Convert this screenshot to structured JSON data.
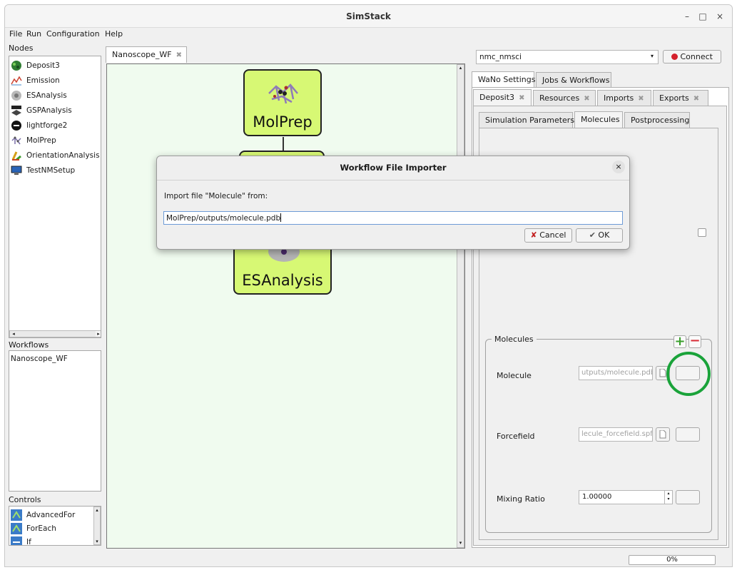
{
  "window": {
    "title": "SimStack",
    "minimize": "–",
    "maximize": "□",
    "close": "×"
  },
  "menu": {
    "file": "File",
    "run": "Run",
    "configuration": "Configuration",
    "help": "Help"
  },
  "nodes": {
    "label": "Nodes",
    "items": [
      {
        "label": "Deposit3",
        "icon": "deposit-icon"
      },
      {
        "label": "Emission",
        "icon": "emission-icon"
      },
      {
        "label": "ESAnalysis",
        "icon": "esanalysis-icon"
      },
      {
        "label": "GSPAnalysis",
        "icon": "gsp-icon"
      },
      {
        "label": "lightforge2",
        "icon": "lightforge-icon"
      },
      {
        "label": "MolPrep",
        "icon": "molecule-icon"
      },
      {
        "label": "OrientationAnalysis",
        "icon": "orientation-icon"
      },
      {
        "label": "TestNMSetup",
        "icon": "monitor-icon"
      }
    ]
  },
  "workflows": {
    "label": "Workflows",
    "items": [
      "Nanoscope_WF"
    ]
  },
  "controls": {
    "label": "Controls",
    "items": [
      "AdvancedFor",
      "ForEach",
      "If"
    ]
  },
  "canvas": {
    "tab": "Nanoscope_WF",
    "nodes": {
      "molprep": "MolPrep",
      "esanalysis": "ESAnalysis"
    }
  },
  "server": {
    "selected": "nmc_nmsci",
    "connect_label": "Connect"
  },
  "right_tabs": {
    "wano_settings": "WaNo Settings",
    "jobs": "Jobs & Workflows"
  },
  "sub_tabs": {
    "deposit": "Deposit3",
    "resources": "Resources",
    "imports": "Imports",
    "exports": "Exports"
  },
  "param_tabs": {
    "simulation": "Simulation Parameters",
    "molecules": "Molecules",
    "post": "Postprocessing"
  },
  "molecules_group": {
    "title": "Molecules",
    "molecule_label": "Molecule",
    "molecule_value": "utputs/molecule.pdb",
    "forcefield_label": "Forcefield",
    "forcefield_value": "lecule_forcefield.spf",
    "mixing_label": "Mixing Ratio",
    "mixing_value": "1.00000"
  },
  "dialog": {
    "title": "Workflow File Importer",
    "prompt": "Import file \"Molecule\" from:",
    "value": "MolPrep/outputs/molecule.pdb",
    "cancel": "Cancel",
    "ok": "OK"
  },
  "status": {
    "progress": "0%"
  },
  "colors": {
    "node_fill": "#d7f874",
    "canvas_bg": "#f0fbef",
    "highlight_ring": "#1aa33a",
    "add_green": "#3aa02c",
    "remove_red": "#d9303a",
    "connect_dot": "#d4202c"
  }
}
